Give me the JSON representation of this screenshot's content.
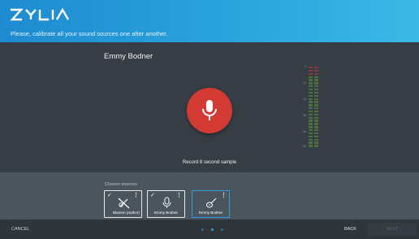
{
  "header": {
    "logo_text": "ZYLIA",
    "subtitle": "Please, calibrate all your sound sources one after another."
  },
  "current_source": {
    "name": "Emmy Bodner"
  },
  "record": {
    "label": "Record 8 second sample"
  },
  "meter": {
    "ticks": [
      "0-",
      "12-",
      "24-",
      "36-",
      "48-",
      "60-"
    ]
  },
  "sources": {
    "label": "Chosen sources",
    "cards": [
      {
        "label": "Blanton (author)",
        "icon": "muted-instrument-icon",
        "checked": true,
        "selected": false
      },
      {
        "label": "Emmy Bodner",
        "icon": "microphone-icon",
        "checked": true,
        "selected": false
      },
      {
        "label": "Emmy Bodner",
        "icon": "guitar-icon",
        "checked": false,
        "selected": true
      }
    ]
  },
  "footer": {
    "cancel": "CANCEL",
    "back": "BACK",
    "next": "NEXT",
    "pagination": {
      "current": 2,
      "total": 3
    }
  },
  "colors": {
    "accent": "#2f9fe0",
    "record": "#d33a34",
    "meter_green": "#5d9a3a",
    "meter_red": "#c0392b"
  }
}
